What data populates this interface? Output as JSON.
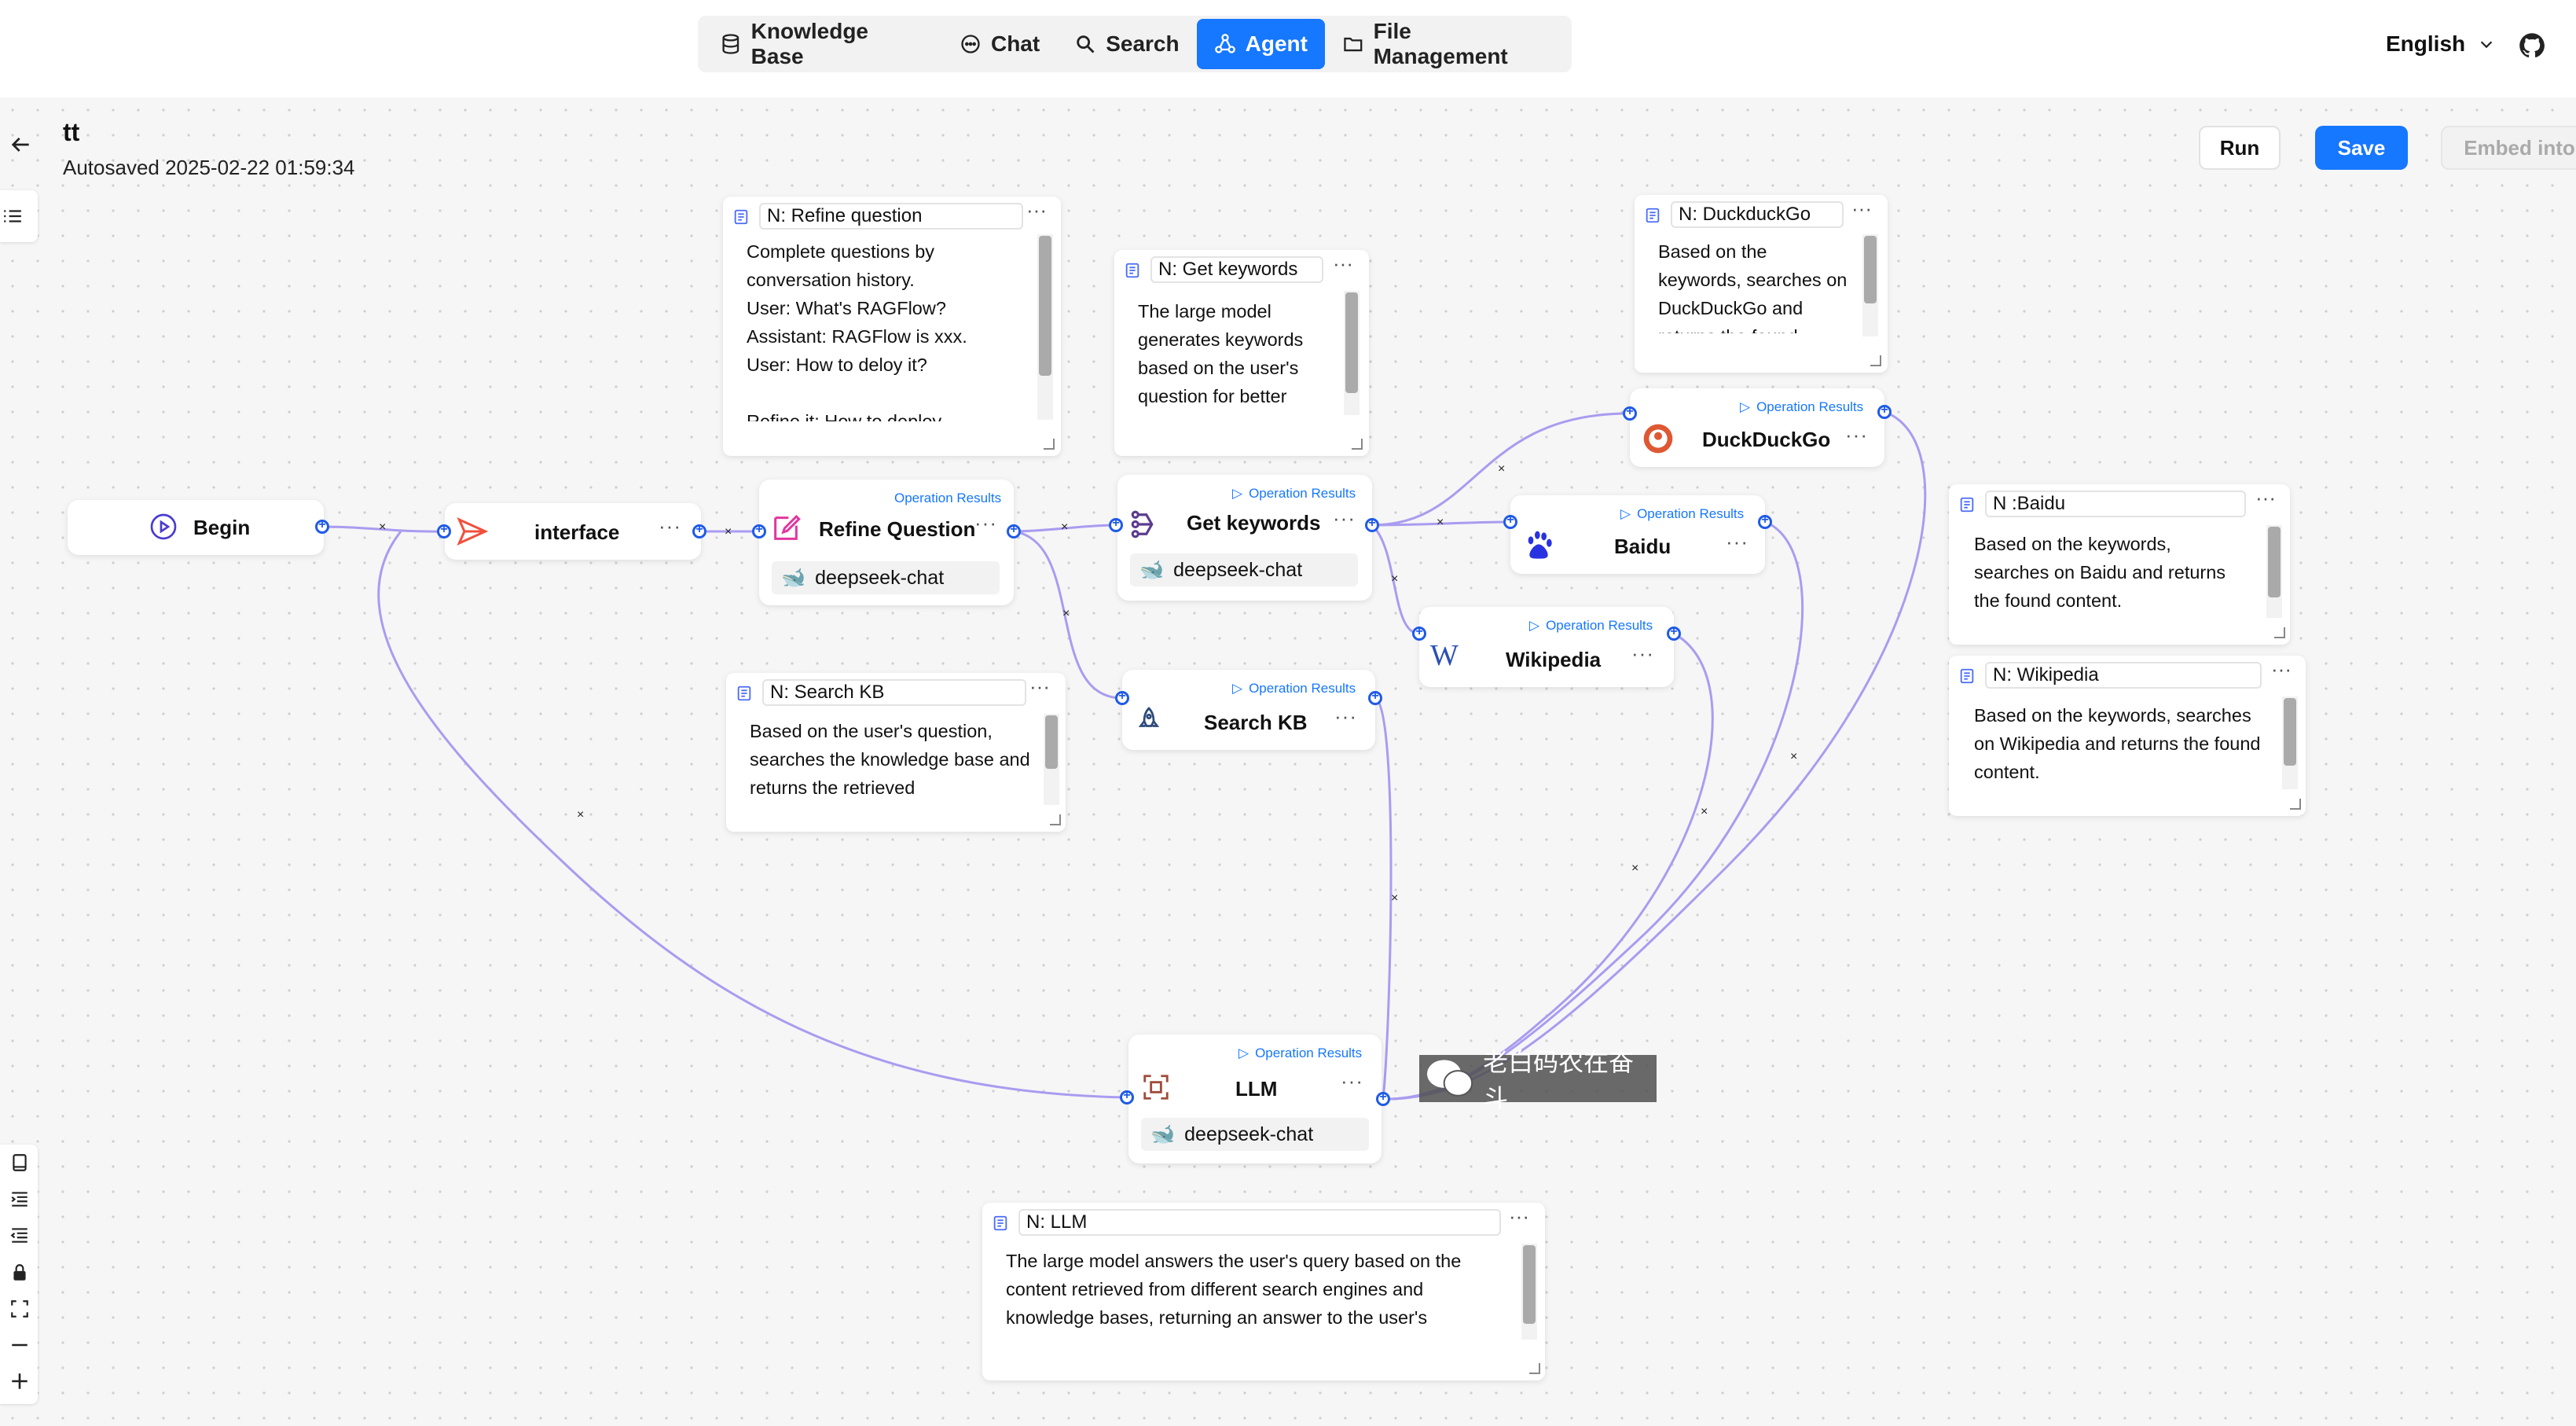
{
  "nav": {
    "tabs": [
      {
        "label": "Knowledge Base",
        "icon": "database-icon"
      },
      {
        "label": "Chat",
        "icon": "chat-bubble-icon"
      },
      {
        "label": "Search",
        "icon": "search-icon"
      },
      {
        "label": "Agent",
        "icon": "agent-graph-icon",
        "active": true
      },
      {
        "label": "File Management",
        "icon": "folder-icon"
      }
    ],
    "language": "English"
  },
  "header": {
    "title": "tt",
    "autosaved": "Autosaved 2025-02-22 01:59:34",
    "run_label": "Run",
    "save_label": "Save",
    "embed_label": "Embed into"
  },
  "colors": {
    "accent": "#1677ff",
    "edge": "#a99cf0",
    "handle": "#1f5ae8"
  },
  "nodes": {
    "begin": {
      "name": "Begin"
    },
    "interface": {
      "name": "interface"
    },
    "refine": {
      "name": "Refine Question",
      "op": "Operation Results",
      "model": "deepseek-chat"
    },
    "keywords": {
      "name": "Get keywords",
      "op": "Operation Results",
      "model": "deepseek-chat"
    },
    "duckduckgo": {
      "name": "DuckDuckGo",
      "op": "Operation Results"
    },
    "baidu": {
      "name": "Baidu",
      "op": "Operation Results"
    },
    "wikipedia": {
      "name": "Wikipedia",
      "op": "Operation Results"
    },
    "searchkb": {
      "name": "Search KB",
      "op": "Operation Results"
    },
    "llm": {
      "name": "LLM",
      "op": "Operation Results",
      "model": "deepseek-chat"
    }
  },
  "notes": {
    "refine": {
      "title": "N: Refine question",
      "body": "Complete questions by conversation history.\nUser: What's RAGFlow?\nAssistant: RAGFlow is xxx.\nUser: How to deloy it?\n\nRefine it: How to deploy"
    },
    "keywords": {
      "title": "N: Get keywords",
      "body": "The large model generates keywords based on the user's question for better"
    },
    "duckduckgo": {
      "title": "N: DuckduckGo",
      "body": "Based on the keywords, searches on DuckDuckGo and returns the found"
    },
    "baidu": {
      "title": "N :Baidu",
      "body": "Based on the keywords, searches on Baidu and returns the found content."
    },
    "wikipedia": {
      "title": "N: Wikipedia",
      "body": "Based on the keywords, searches on Wikipedia and returns the found content."
    },
    "searchkb": {
      "title": "N: Search KB",
      "body": "Based on the user's question, searches the knowledge base and returns the retrieved"
    },
    "llm": {
      "title": "N: LLM",
      "body": "The large model answers the user's query based on the content retrieved from different search engines and knowledge bases, returning an answer to the user's question."
    }
  },
  "watermark": "老白码农在奋斗",
  "controls": [
    "notebook-icon",
    "list-indent-icon",
    "list-outdent-icon",
    "lock-icon",
    "fit-view-icon",
    "zoom-out-icon",
    "zoom-in-icon"
  ]
}
